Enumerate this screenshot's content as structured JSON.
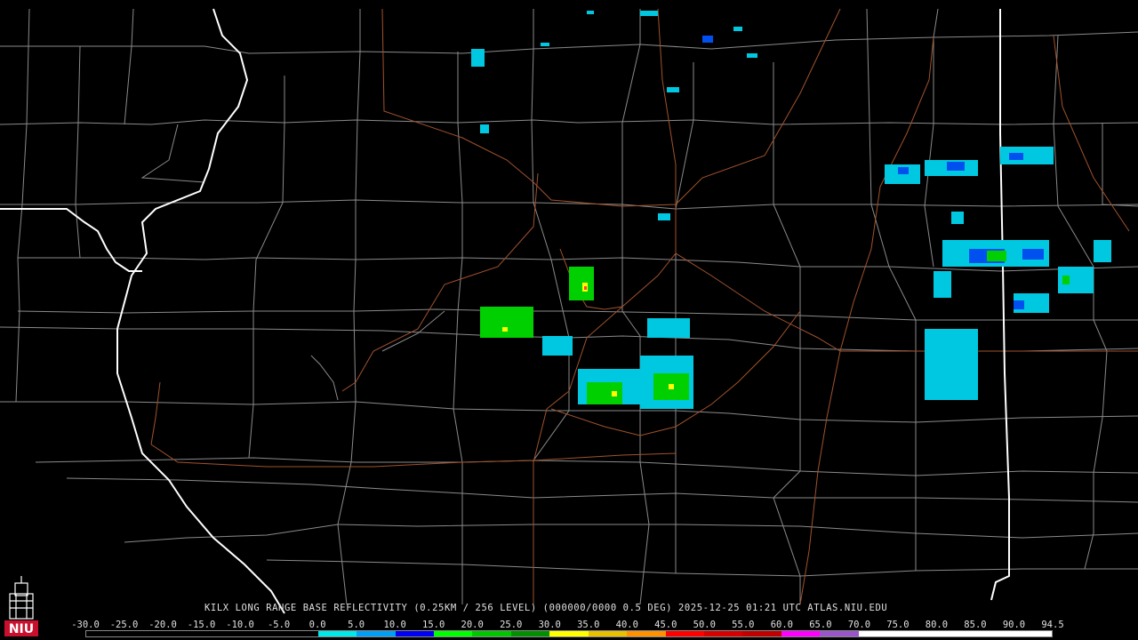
{
  "map": {
    "caption": "KILX LONG RANGE BASE REFLECTIVITY (0.25KM / 256 LEVEL) (000000/0000 0.5 DEG) 2025-12-25 01:21 UTC  ATLAS.NIU.EDU",
    "colors": {
      "background": "#000000",
      "county_lines": "#8a8a8a",
      "state_lines": "#ffffff",
      "highways": "#a0522d"
    },
    "scale": {
      "labels": [
        "-30.0",
        "-25.0",
        "-20.0",
        "-15.0",
        "-10.0",
        "-5.0",
        "0.0",
        "5.0",
        "10.0",
        "15.0",
        "20.0",
        "25.0",
        "30.0",
        "35.0",
        "40.0",
        "45.0",
        "50.0",
        "55.0",
        "60.0",
        "65.0",
        "70.0",
        "75.0",
        "80.0",
        "85.0",
        "90.0",
        "94.5"
      ],
      "colors": [
        "#000000",
        "#000000",
        "#000000",
        "#000000",
        "#000000",
        "#000000",
        "#00e8e8",
        "#00a0f6",
        "#0000f6",
        "#00ff00",
        "#00c800",
        "#009000",
        "#ffff00",
        "#e7c000",
        "#ff9000",
        "#ff0000",
        "#d60000",
        "#c00000",
        "#ff00ff",
        "#9955c9",
        "#ffffff",
        "#ffffff",
        "#ffffff",
        "#ffffff",
        "#ffffff"
      ]
    },
    "logo": {
      "text": "NIU",
      "color": "#c8102e"
    }
  }
}
